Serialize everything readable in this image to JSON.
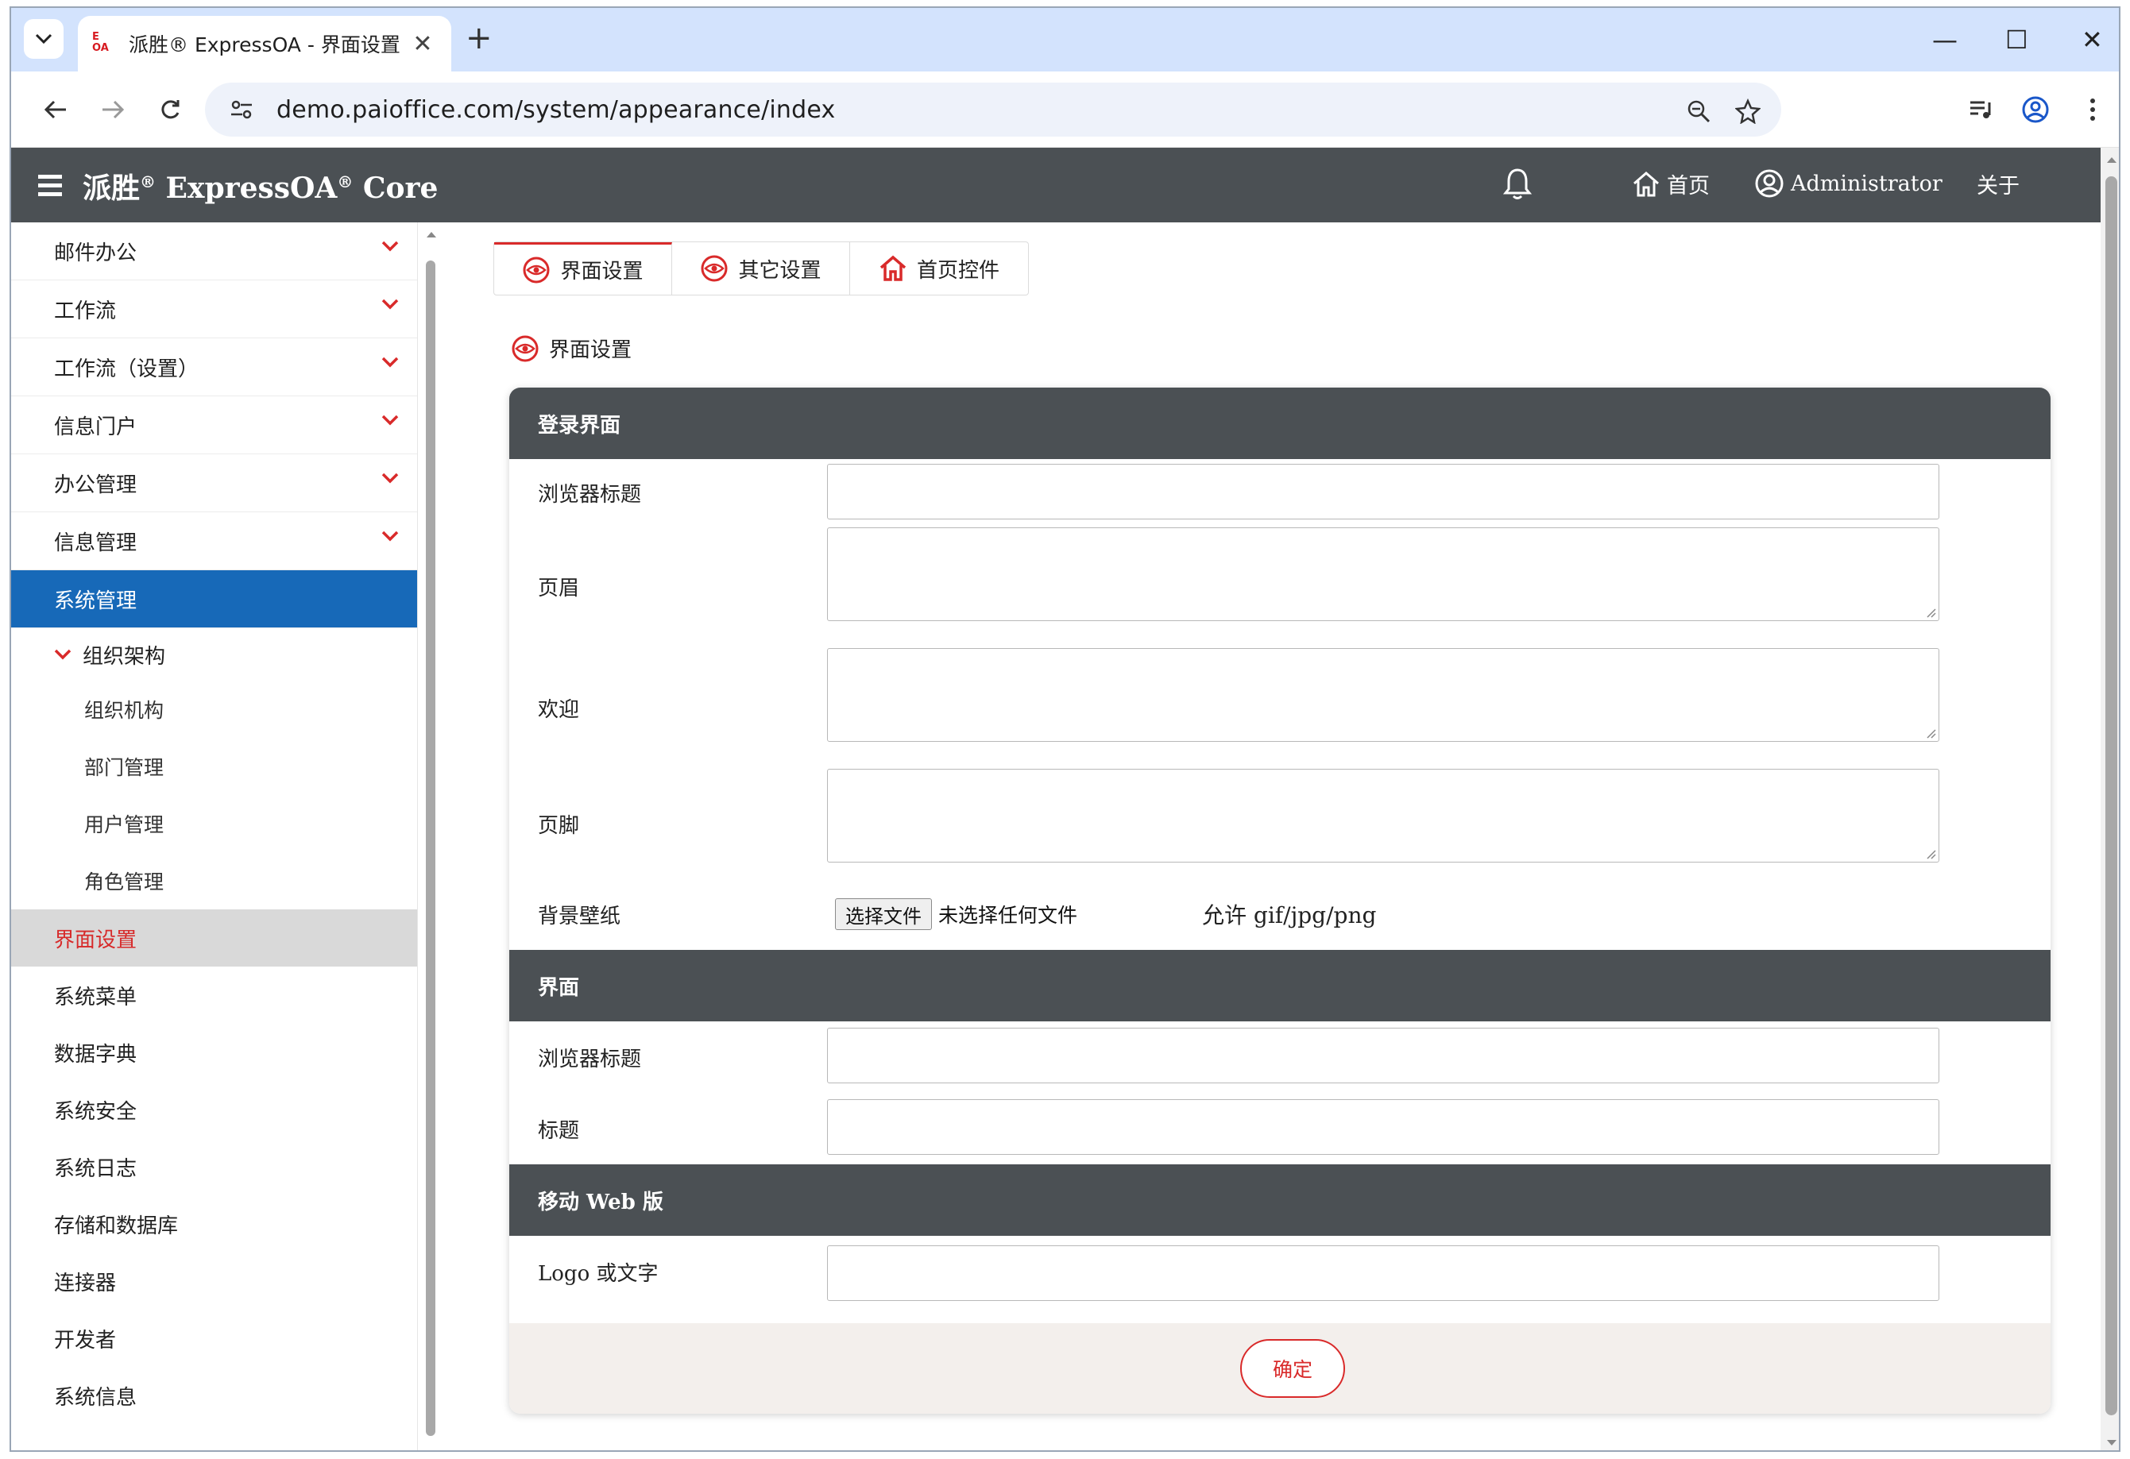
{
  "browser": {
    "tab_title": "派胜® ExpressOA - 界面设置",
    "favicon_text": "E\nOA",
    "new_tab": "+",
    "url": "demo.paioffice.com/system/appearance/index"
  },
  "header": {
    "brand": "派胜",
    "brand_mid": " ExpressOA",
    "brand_tail": " Core",
    "home": "首页",
    "user": "Administrator",
    "about": "关于"
  },
  "sidebar": {
    "items": [
      {
        "label": "邮件办公"
      },
      {
        "label": "工作流"
      },
      {
        "label": "工作流（设置）"
      },
      {
        "label": "信息门户"
      },
      {
        "label": "办公管理"
      },
      {
        "label": "信息管理"
      },
      {
        "label": "系统管理"
      }
    ],
    "group": "组织架构",
    "group_items": [
      "组织机构",
      "部门管理",
      "用户管理",
      "角色管理"
    ],
    "current": "界面设置",
    "rest": [
      "系统菜单",
      "数据字典",
      "系统安全",
      "系统日志",
      "存储和数据库",
      "连接器",
      "开发者",
      "系统信息"
    ]
  },
  "tabs": [
    {
      "label": "界面设置",
      "icon": "eye-icon"
    },
    {
      "label": "其它设置",
      "icon": "eye-icon"
    },
    {
      "label": "首页控件",
      "icon": "home-icon"
    }
  ],
  "section_caption": "界面设置",
  "login_section": {
    "heading": "登录界面",
    "browser_title_label": "浏览器标题",
    "header_label": "页眉",
    "welcome_label": "欢迎",
    "footer_label": "页脚",
    "wallpaper_label": "背景壁纸",
    "file_button": "选择文件",
    "file_status": "未选择任何文件",
    "file_hint": "允许 gif/jpg/png"
  },
  "ui_section": {
    "heading": "界面",
    "browser_title_label": "浏览器标题",
    "title_label": "标题"
  },
  "mobile_section": {
    "heading": "移动 Web 版",
    "logo_label": "Logo 或文字"
  },
  "submit_label": "确定",
  "colors": {
    "header_bg": "#4b5054",
    "accent_red": "#d92a2a",
    "active_blue": "#1769b8"
  }
}
